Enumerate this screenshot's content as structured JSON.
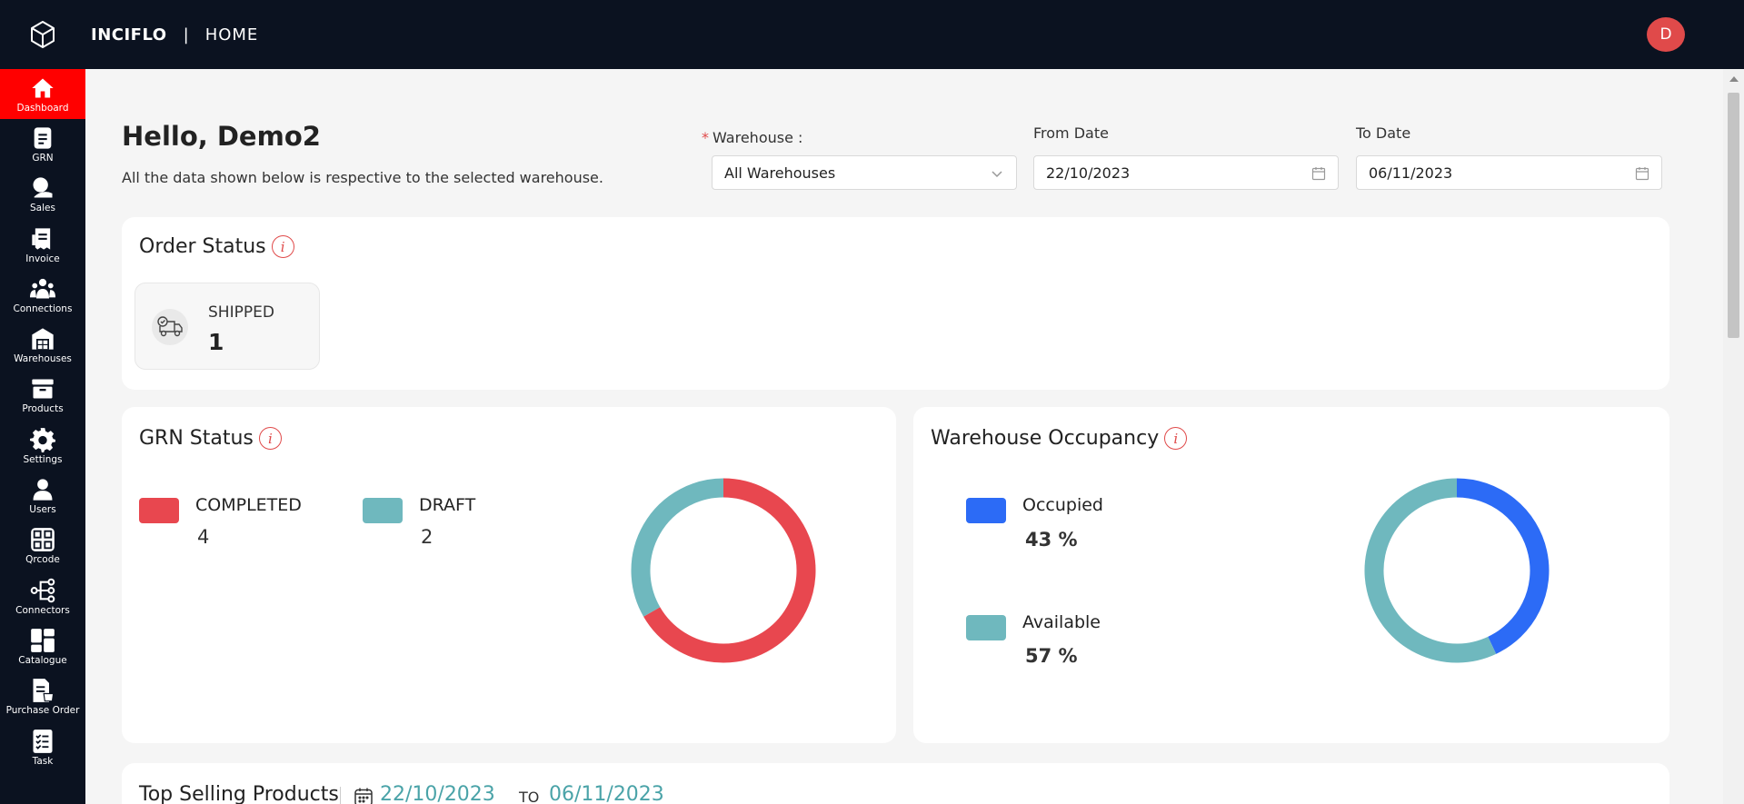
{
  "header": {
    "brand": "INCIFLO",
    "separator": "|",
    "breadcrumb": "HOME",
    "avatar_initial": "D"
  },
  "sidebar": {
    "items": [
      {
        "label": "Dashboard",
        "icon": "home-icon",
        "active": true
      },
      {
        "label": "GRN",
        "icon": "document-icon"
      },
      {
        "label": "Sales",
        "icon": "sales-icon"
      },
      {
        "label": "Invoice",
        "icon": "invoice-icon"
      },
      {
        "label": "Connections",
        "icon": "people-icon"
      },
      {
        "label": "Warehouses",
        "icon": "warehouse-icon"
      },
      {
        "label": "Products",
        "icon": "box-icon"
      },
      {
        "label": "Settings",
        "icon": "gear-icon"
      },
      {
        "label": "Users",
        "icon": "user-icon"
      },
      {
        "label": "Qrcode",
        "icon": "qrcode-icon"
      },
      {
        "label": "Connectors",
        "icon": "connectors-icon"
      },
      {
        "label": "Catalogue",
        "icon": "catalogue-icon"
      },
      {
        "label": "Purchase Order",
        "icon": "purchase-order-icon"
      },
      {
        "label": "Task",
        "icon": "task-icon"
      }
    ]
  },
  "main": {
    "greeting": "Hello, Demo2",
    "subtext": "All the data shown below is respective to the selected warehouse.",
    "filters": {
      "warehouse_required": "*",
      "warehouse_label": "Warehouse :",
      "warehouse_value": "All Warehouses",
      "from_label": "From Date",
      "from_value": "22/10/2023",
      "to_label": "To Date",
      "to_value": "06/11/2023"
    }
  },
  "order_status": {
    "title": "Order Status",
    "info": "i",
    "shipped_label": "SHIPPED",
    "shipped_count": "1"
  },
  "grn_status": {
    "title": "GRN Status",
    "info": "i",
    "legend": [
      {
        "label": "COMPLETED",
        "value": "4",
        "color": "#e8474f"
      },
      {
        "label": "DRAFT",
        "value": "2",
        "color": "#6fb8be"
      }
    ]
  },
  "warehouse_occupancy": {
    "title": "Warehouse Occupancy",
    "info": "i",
    "legend": [
      {
        "label": "Occupied",
        "value": "43 %",
        "color": "#2c6bf6"
      },
      {
        "label": "Available",
        "value": "57 %",
        "color": "#6fb8be"
      }
    ]
  },
  "top_selling": {
    "title": "Top Selling Products",
    "from": "22/10/2023",
    "to_word": "TO",
    "to": "06/11/2023"
  },
  "chart_data": [
    {
      "type": "pie",
      "categories": [
        "COMPLETED",
        "DRAFT"
      ],
      "values": [
        4,
        2
      ],
      "colors": [
        "#e8474f",
        "#6fb8be"
      ]
    },
    {
      "type": "pie",
      "categories": [
        "Occupied",
        "Available"
      ],
      "values": [
        43,
        57
      ],
      "colors": [
        "#2c6bf6",
        "#6fb8be"
      ]
    }
  ]
}
